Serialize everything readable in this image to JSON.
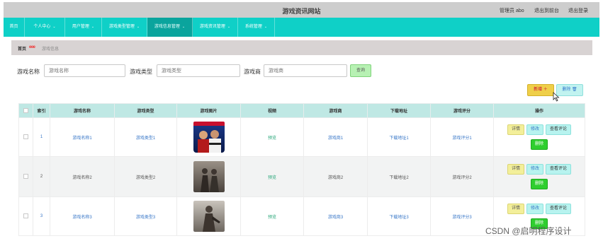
{
  "header": {
    "title": "游戏资讯网站",
    "admin_label": "管理员 abo",
    "backend_link": "退出到前台",
    "logout_link": "退出登录"
  },
  "nav": {
    "items": [
      {
        "label": "首页",
        "caret": ""
      },
      {
        "label": "个人中心",
        "caret": "⌄"
      },
      {
        "label": "用户管理",
        "caret": "⌄"
      },
      {
        "label": "游戏类型管理",
        "caret": "⌄"
      },
      {
        "label": "游戏信息管理",
        "caret": "⌄"
      },
      {
        "label": "游戏资讯管理",
        "caret": "⌄"
      },
      {
        "label": "系统管理",
        "caret": "⌄"
      }
    ],
    "active_index": 4
  },
  "breadcrumb": {
    "home": "首页",
    "separator": "eee",
    "current": "游戏信息"
  },
  "search": {
    "name_label": "游戏名称",
    "name_placeholder": "游戏名称",
    "type_label": "游戏类型",
    "type_placeholder": "游戏类型",
    "vendor_label": "游戏商",
    "vendor_placeholder": "游戏商",
    "button": "查询"
  },
  "actions": {
    "add": "新增 ＋",
    "delete": "删除 🗑"
  },
  "table": {
    "columns": [
      "索引",
      "游戏名称",
      "游戏类型",
      "游戏图片",
      "视频",
      "游戏商",
      "下载地址",
      "游戏评分",
      "操作"
    ],
    "rows": [
      {
        "index": "1",
        "name": "游戏名称1",
        "type": "游戏类型1",
        "video": "预览",
        "vendor": "游戏商1",
        "download": "下载地址1",
        "score": "游戏评分1"
      },
      {
        "index": "2",
        "name": "游戏名称2",
        "type": "游戏类型2",
        "video": "预览",
        "vendor": "游戏商2",
        "download": "下载地址2",
        "score": "游戏评分2"
      },
      {
        "index": "3",
        "name": "游戏名称3",
        "type": "游戏类型3",
        "video": "预览",
        "vendor": "游戏商3",
        "download": "下载地址3",
        "score": "游戏评分3"
      }
    ],
    "row_actions": {
      "detail": "详情",
      "edit": "修改",
      "review": "查看评论",
      "remove": "删除"
    }
  },
  "watermark": "CSDN @启明程序设计",
  "colors": {
    "nav_bg": "#0fd0c7",
    "header_bg": "#cdcdcd",
    "table_header_bg": "#bfe8e4",
    "add_button": "#efcf49",
    "remove_button": "#2fce2f"
  }
}
